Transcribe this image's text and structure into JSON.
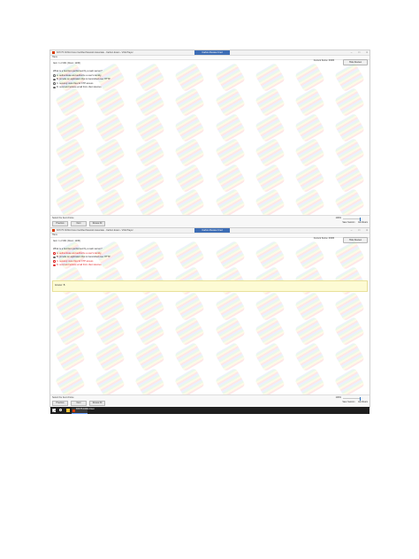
{
  "window": {
    "title": "NYFY5 CCNA Cisco Certified Network Associate - Carbon Exam - VCE Player",
    "center_tab": "Carbon Review Cred",
    "menu_label": "Hans"
  },
  "screens": [
    {
      "item_info": "Item: 1 of 461 (Cisco: 1236)",
      "current_score": "Current Score: 3/305",
      "hide_review": "Hide Review",
      "question": "What is a function performed by a web server?",
      "options": [
        {
          "letter": "A.",
          "text": "authenticate and authorize a user's identity",
          "style": "normal"
        },
        {
          "letter": "B.",
          "text": "provide an application that is transmitted over HTTP",
          "style": "normal"
        },
        {
          "letter": "C.",
          "text": "securely store files for FTP access",
          "style": "normal"
        },
        {
          "letter": "D.",
          "text": "send and retrieve email from client devices",
          "style": "normal"
        }
      ],
      "answer_text": "",
      "status_text": "Select the best choice",
      "zoom": "100%",
      "buttons": {
        "previous": "Previous",
        "next": "Next",
        "review": "Review All",
        "save": "Save Session",
        "end": "End Exam"
      }
    },
    {
      "item_info": "Item: 1 of 461 (Cisco: 1236)",
      "current_score": "Current Score: 3/305",
      "hide_review": "Hide Review",
      "question": "What is a function performed by a web server?",
      "options": [
        {
          "letter": "A.",
          "text": "authenticate and authorize a user's identity",
          "style": "red"
        },
        {
          "letter": "B.",
          "text": "provide an application that is transmitted over HTTP",
          "style": "normal"
        },
        {
          "letter": "C.",
          "text": "securely store files for FTP access",
          "style": "red"
        },
        {
          "letter": "D.",
          "text": "send and retrieve email from client devices",
          "style": "red"
        }
      ],
      "answer_text": "Answer: B",
      "status_text": "Select the best choice",
      "zoom": "100%",
      "buttons": {
        "previous": "Previous",
        "next": "Next",
        "review": "Review All",
        "save": "Save Session",
        "end": "End Exam"
      }
    }
  ],
  "taskbar": {
    "app_label": "NYFY5 CCNA Cisco"
  },
  "colors": {
    "incorrect": "#e02424",
    "answer_bg": "#fdfbd4",
    "accent": "#3d6db5"
  }
}
